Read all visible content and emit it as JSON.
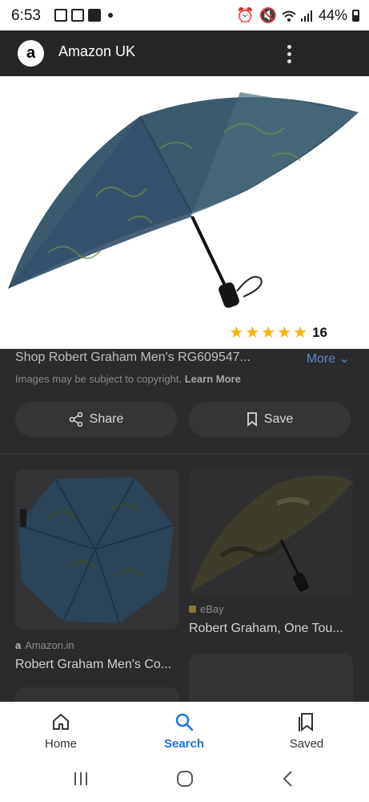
{
  "status": {
    "time": "6:53",
    "battery": "44%"
  },
  "app": {
    "title": "Amazon UK",
    "logo_letter": "a"
  },
  "hero": {
    "rating_count": "16",
    "stars": 5
  },
  "product": {
    "title": "Shop Robert Graham Men's RG609547...",
    "more_label": "More",
    "copyright_text": "Images may be subject to copyright.",
    "learn_more": "Learn More"
  },
  "actions": {
    "share_label": "Share",
    "save_label": "Save"
  },
  "results": [
    {
      "source": "Amazon.in",
      "title": "Robert Graham Men's Co..."
    },
    {
      "source": "eBay",
      "title": "Robert Graham, One Tou..."
    }
  ],
  "bottom_nav": {
    "home": "Home",
    "search": "Search",
    "saved": "Saved"
  },
  "colors": {
    "accent": "#1a73e8",
    "star": "#f5b400"
  }
}
